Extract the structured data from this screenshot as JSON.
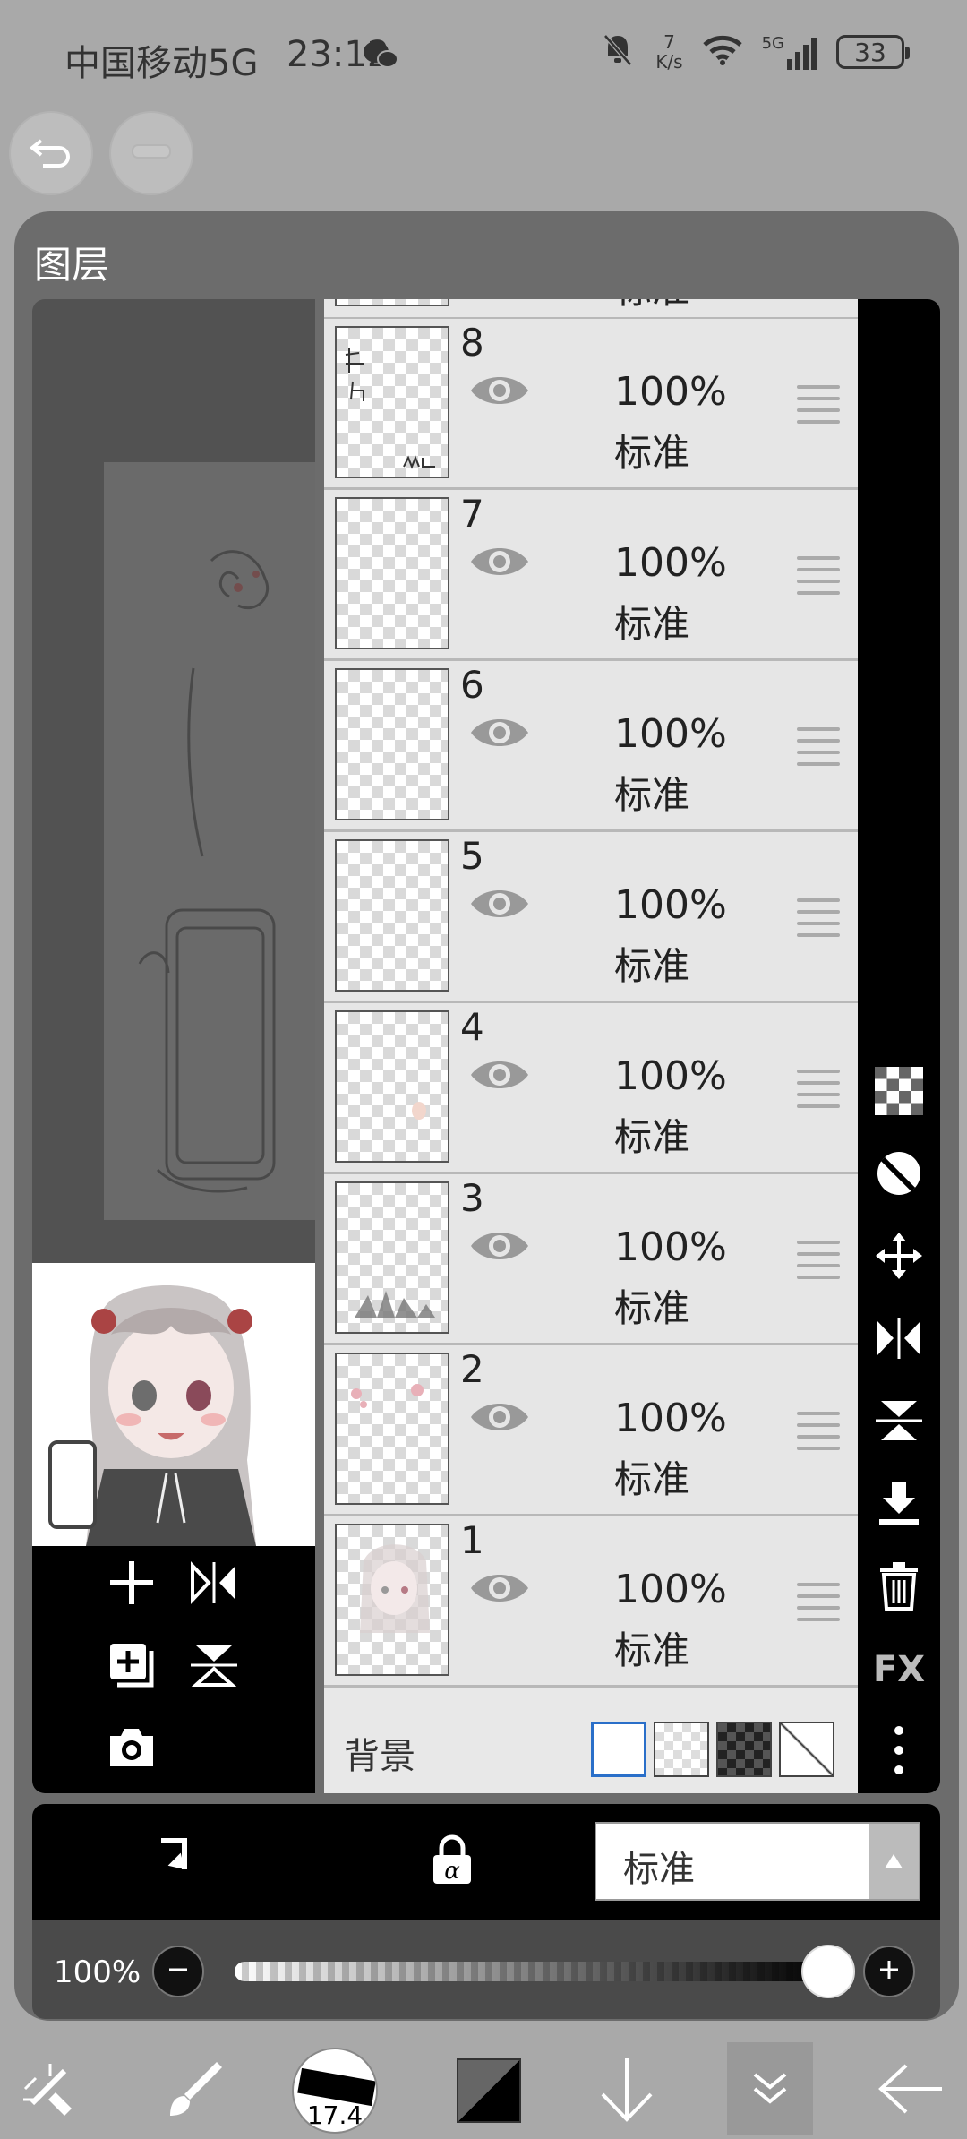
{
  "status_bar": {
    "carrier": "中国移动5G",
    "time": "23:12",
    "net_speed_value": "7",
    "net_speed_unit": "K/s",
    "network_type": "5G",
    "battery": "33"
  },
  "panel": {
    "title": "图层"
  },
  "layers": [
    {
      "number": "8",
      "opacity": "100%",
      "mode": "标准"
    },
    {
      "number": "7",
      "opacity": "100%",
      "mode": "标准"
    },
    {
      "number": "6",
      "opacity": "100%",
      "mode": "标准"
    },
    {
      "number": "5",
      "opacity": "100%",
      "mode": "标准"
    },
    {
      "number": "4",
      "opacity": "100%",
      "mode": "标准"
    },
    {
      "number": "3",
      "opacity": "100%",
      "mode": "标准"
    },
    {
      "number": "2",
      "opacity": "100%",
      "mode": "标准"
    },
    {
      "number": "1",
      "opacity": "100%",
      "mode": "标准"
    }
  ],
  "partial_top_layer_mode": "标准",
  "background_row": {
    "label": "背景"
  },
  "right_tools": {
    "fx_label": "FX"
  },
  "blend": {
    "selected_mode": "标准"
  },
  "opacity": {
    "label": "100%",
    "value": 1.0
  },
  "toolbar": {
    "brush_size": "17.4"
  },
  "colors": {
    "panel": "#6c6c6c",
    "layer_bg": "#e6e6e6",
    "selected_bg_swatch_border": "#2a6fc9"
  }
}
